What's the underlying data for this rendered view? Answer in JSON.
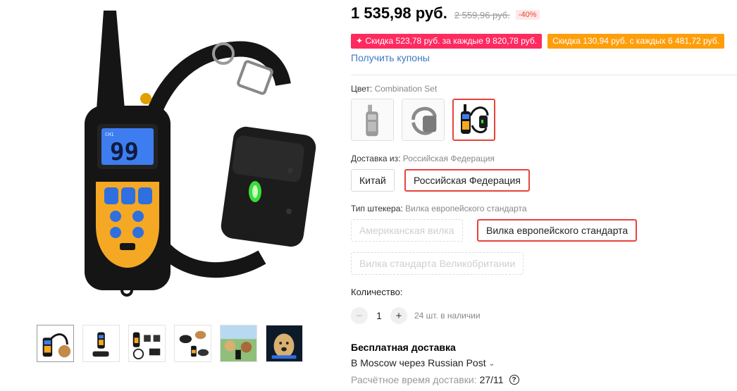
{
  "price": {
    "current": "1 535,98 руб.",
    "old": "2 559,96 руб.",
    "discount_badge": "-40%"
  },
  "promos": [
    {
      "label": "✦ Скидка 523,78 руб. за каждые 9 820,78 руб.",
      "color": "#ff2a5f"
    },
    {
      "label": "Скидка 130,94 руб. с каждых 6 481,72 руб.",
      "color": "#ff9e0b"
    }
  ],
  "coupons_link": "Получить купоны",
  "color_prop": {
    "label": "Цвет: ",
    "value": "Combination Set",
    "options": [
      "remote-only",
      "collar-only",
      "combination-set"
    ],
    "selected_index": 2
  },
  "ship_from": {
    "label": "Доставка из: ",
    "value": "Российская Федерация",
    "options": [
      "Китай",
      "Российская Федерация"
    ],
    "selected_index": 1
  },
  "plug_type": {
    "label": "Тип штекера: ",
    "value": "Вилка европейского стандарта",
    "options": [
      "Американская вилка",
      "Вилка европейского стандарта",
      "Вилка стандарта Великобритании"
    ],
    "selected_index": 1
  },
  "quantity": {
    "label": "Количество:",
    "minus": "−",
    "value": "1",
    "plus": "+",
    "stock": "24 шт. в наличии"
  },
  "shipping": {
    "title": "Бесплатная доставка",
    "via": "В Moscow через Russian Post",
    "eta_label": "Расчётное время доставки:",
    "eta_date": "27/11",
    "help": "?"
  },
  "device_display": "99",
  "device_channel": "CH1",
  "icons": {
    "shock": "lightning-icon",
    "vibrate": "vibration-icon",
    "beep": "speaker-icon",
    "minus": "minus-icon",
    "plus": "plus-icon",
    "channel": "ch-icon",
    "light": "light-icon",
    "chevron": "chevron-down-icon",
    "help": "question-icon"
  },
  "colors": {
    "accent_red": "#e8443a",
    "link_blue": "#3f79c4",
    "remote_yellow": "#f5a823",
    "screen_blue": "#3d7df0"
  },
  "thumbnails": [
    "thumb-1",
    "thumb-2",
    "thumb-3",
    "thumb-4",
    "thumb-5",
    "thumb-6"
  ]
}
